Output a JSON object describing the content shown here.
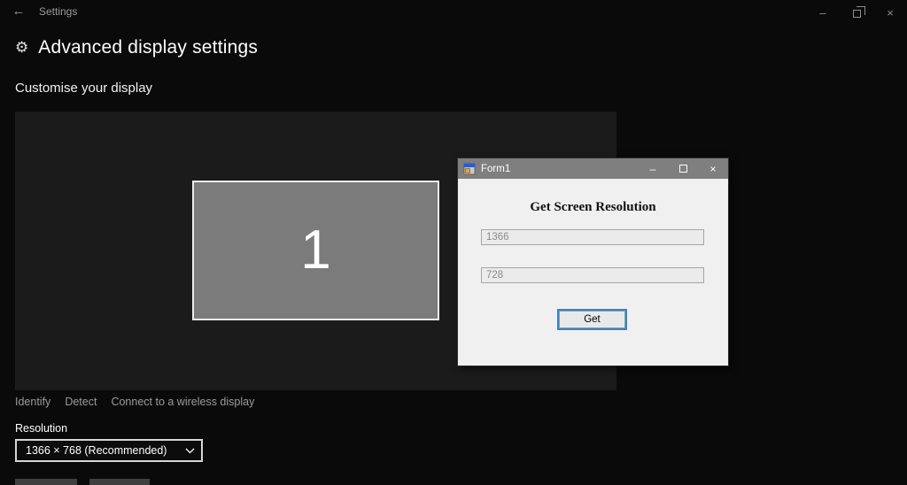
{
  "icons": {
    "back": "←",
    "gear": "⚙",
    "minimize": "–",
    "close": "×",
    "form_minimize": "–",
    "form_close": "×"
  },
  "titlebar": {
    "app_title": "Settings"
  },
  "page": {
    "title": "Advanced display settings",
    "section_heading": "Customise your display",
    "monitor_number": "1",
    "links": {
      "identify": "Identify",
      "detect": "Detect",
      "connect": "Connect to a wireless display"
    },
    "resolution": {
      "label": "Resolution",
      "selected": "1366 × 768 (Recommended)"
    }
  },
  "form_window": {
    "title": "Form1",
    "heading": "Get Screen Resolution",
    "width_value": "1366",
    "height_value": "728",
    "get_label": "Get"
  },
  "colors": {
    "accent_blue": "#2e86d3",
    "panel_bg": "#1b1b1b",
    "monitor_fill": "#7b7b7b",
    "form_titlebar": "#7f7f7f",
    "form_body": "#f0f0f0"
  }
}
